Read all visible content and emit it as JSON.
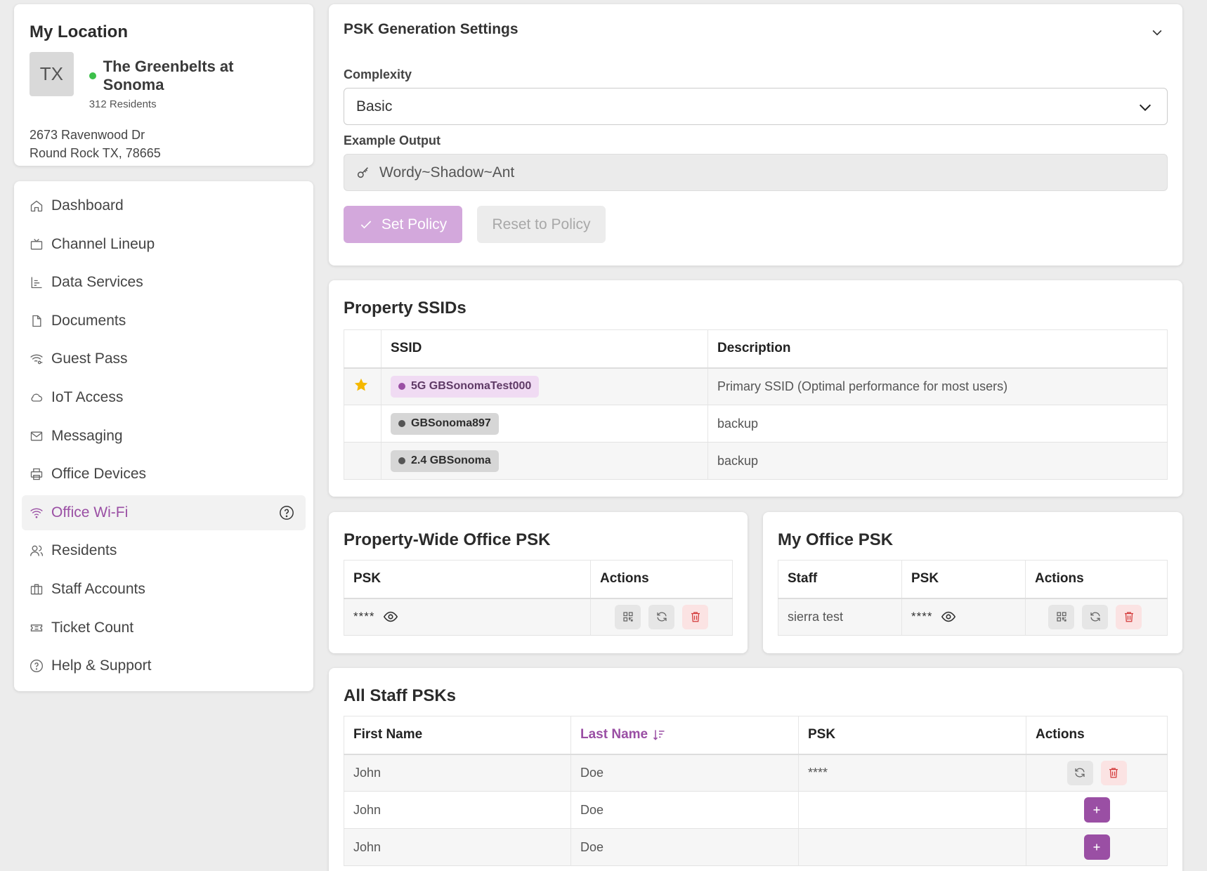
{
  "location": {
    "heading": "My Location",
    "state_abbr": "TX",
    "name": "The Greenbelts at Sonoma",
    "residents": "312 Residents",
    "address_line1": "2673 Ravenwood Dr",
    "address_line2": "Round Rock TX, 78665",
    "status_color": "#3cc04a"
  },
  "nav": {
    "items": [
      {
        "label": "Dashboard",
        "icon": "home-icon"
      },
      {
        "label": "Channel Lineup",
        "icon": "tv-icon"
      },
      {
        "label": "Data Services",
        "icon": "chart-icon"
      },
      {
        "label": "Documents",
        "icon": "document-icon"
      },
      {
        "label": "Guest Pass",
        "icon": "wifi-key-icon"
      },
      {
        "label": "IoT Access",
        "icon": "cloud-icon"
      },
      {
        "label": "Messaging",
        "icon": "mail-icon"
      },
      {
        "label": "Office Devices",
        "icon": "printer-icon"
      },
      {
        "label": "Office Wi-Fi",
        "icon": "wifi-icon",
        "active": true
      },
      {
        "label": "Residents",
        "icon": "users-icon"
      },
      {
        "label": "Staff Accounts",
        "icon": "briefcase-icon"
      },
      {
        "label": "Ticket Count",
        "icon": "ticket-icon"
      },
      {
        "label": "Help & Support",
        "icon": "help-circle-icon"
      }
    ],
    "accent": "#9a4fa4"
  },
  "psk_gen": {
    "title": "PSK Generation Settings",
    "complexity_label": "Complexity",
    "complexity_value": "Basic",
    "example_label": "Example Output",
    "example_value": "Wordy~Shadow~Ant",
    "set_policy": "Set Policy",
    "reset_policy": "Reset to Policy"
  },
  "ssids": {
    "title": "Property SSIDs",
    "headers": [
      "",
      "SSID",
      "Description"
    ],
    "rows": [
      {
        "starred": true,
        "ssid": "5G GBSonomaTest000",
        "description": "Primary SSID (Optimal performance for most users)"
      },
      {
        "starred": false,
        "ssid": "GBSonoma897",
        "description": "backup"
      },
      {
        "starred": false,
        "ssid": "2.4 GBSonoma",
        "description": "backup"
      }
    ]
  },
  "property_psk": {
    "title": "Property-Wide Office PSK",
    "headers": [
      "PSK",
      "Actions"
    ],
    "psk_masked": "****"
  },
  "my_psk": {
    "title": "My Office PSK",
    "headers": [
      "Staff",
      "PSK",
      "Actions"
    ],
    "staff": "sierra test",
    "psk_masked": "****"
  },
  "staff_psks": {
    "title": "All Staff PSKs",
    "headers": [
      "First Name",
      "Last Name",
      "PSK",
      "Actions"
    ],
    "rows": [
      {
        "first": "John",
        "last": "Doe",
        "psk": "****",
        "has_psk": true
      },
      {
        "first": "John",
        "last": "Doe",
        "psk": "",
        "has_psk": false
      },
      {
        "first": "John",
        "last": "Doe",
        "psk": "",
        "has_psk": false
      }
    ]
  }
}
